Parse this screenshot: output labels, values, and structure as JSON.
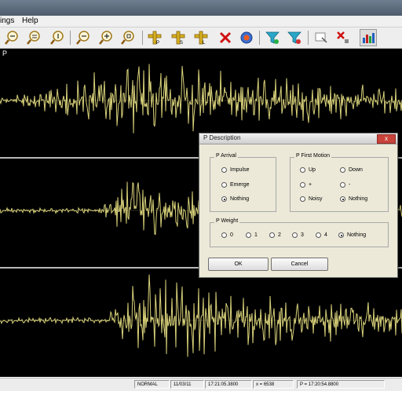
{
  "menu": {
    "items": [
      {
        "label": "ings"
      },
      {
        "label": "Help"
      }
    ]
  },
  "toolbar": {
    "buttons": [
      {
        "name": "zoom-in-horizontal-icon"
      },
      {
        "name": "zoom-out-horizontal-icon"
      },
      {
        "name": "zoom-in-vertical-icon"
      },
      {
        "name": "zoom-out-vertical-icon"
      },
      {
        "name": "zoom-plus-icon"
      },
      {
        "name": "zoom-reset-icon"
      },
      {
        "name": "pick-p-icon"
      },
      {
        "name": "pick-s-icon"
      },
      {
        "name": "pick-l-icon"
      },
      {
        "name": "delete-pick-icon"
      },
      {
        "name": "locate-icon"
      },
      {
        "name": "filter-icon"
      },
      {
        "name": "filter-remove-icon"
      },
      {
        "name": "select-icon"
      },
      {
        "name": "delete-selection-icon"
      },
      {
        "name": "bar-chart-icon"
      }
    ]
  },
  "plot": {
    "channel_label": "P"
  },
  "dialog": {
    "title": "P Description",
    "close_label": "x",
    "arrival": {
      "title": "P Arrival",
      "options": [
        "Impulse",
        "Emerge",
        "Nothing"
      ],
      "selected": "Nothing"
    },
    "first_motion": {
      "title": "P First Motion",
      "options": [
        "Up",
        "Down",
        "+",
        "-",
        "Noisy",
        "Nothing"
      ],
      "selected": "Nothing"
    },
    "weight": {
      "title": "P Weight",
      "options": [
        "0",
        "1",
        "2",
        "3",
        "4",
        "Nothing"
      ],
      "selected": "Nothing"
    },
    "ok_label": "OK",
    "cancel_label": "Cancel"
  },
  "status": {
    "mode": "NORMAL",
    "date": "11/03/11",
    "time": "17:21:05.3800",
    "x_value": "x = 6538",
    "p_time": "P = 17:20:54.8800"
  },
  "colors": {
    "trace": "#d9d27a",
    "background": "#000000",
    "separator": "#b8b8b8"
  }
}
